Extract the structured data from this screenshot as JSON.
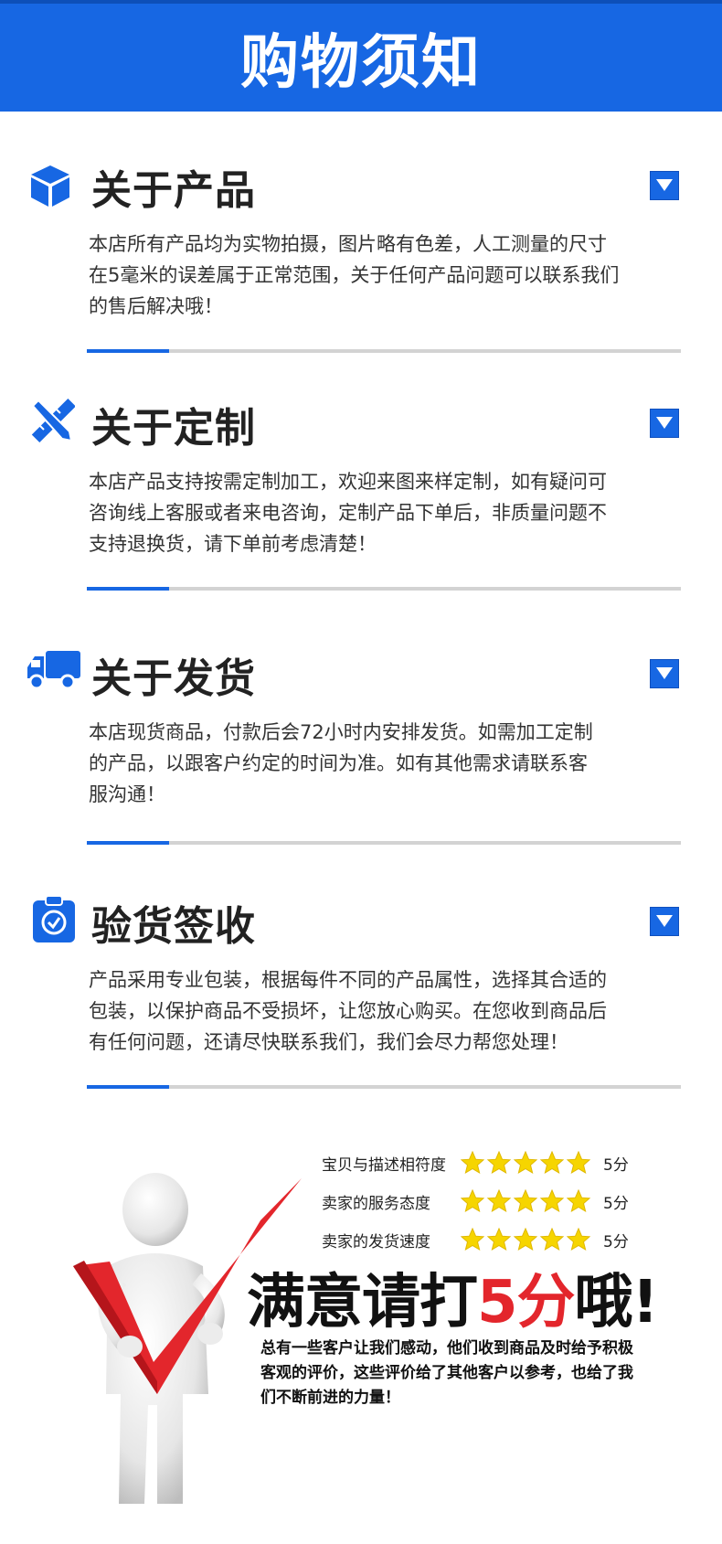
{
  "header": {
    "title": "购物须知"
  },
  "sections": [
    {
      "icon": "box-icon",
      "title": "关于产品",
      "lines": [
        "本店所有产品均为实物拍摄，图片略有色差，人工测量的尺寸",
        "在5毫米的误差属于正常范围，关于任何产品问题可以联系我们",
        "的售后解决哦！"
      ]
    },
    {
      "icon": "pencil-ruler-icon",
      "title": "关于定制",
      "lines": [
        "本店产品支持按需定制加工，欢迎来图来样定制，如有疑问可",
        "咨询线上客服或者来电咨询，定制产品下单后，非质量问题不",
        "支持退换货，请下单前考虑清楚！"
      ]
    },
    {
      "icon": "truck-icon",
      "title": "关于发货",
      "lines": [
        "本店现货商品，付款后会72小时内安排发货。如需加工定制",
        "的产品，以跟客户约定的时间为准。如有其他需求请联系客",
        "服沟通！"
      ]
    },
    {
      "icon": "clipboard-check-icon",
      "title": "验货签收",
      "lines": [
        "产品采用专业包装，根据每件不同的产品属性，选择其合适的",
        "包装，以保护商品不受损坏，让您放心购买。在您收到商品后",
        "有任何问题，还请尽快联系我们，我们会尽力帮您处理！"
      ]
    }
  ],
  "ratings": [
    {
      "label": "宝贝与描述相符度",
      "stars": 5,
      "score": "5分"
    },
    {
      "label": "卖家的服务态度",
      "stars": 5,
      "score": "5分"
    },
    {
      "label": "卖家的发货速度",
      "stars": 5,
      "score": "5分"
    }
  ],
  "slogan": {
    "before": "满意请打",
    "highlight": "5分",
    "after": "哦!"
  },
  "thanks_lines": [
    "总有一些客户让我们感动，他们收到商品及时给予积极",
    "客观的评价，这些评价给了其他客户以参考，也给了我",
    "们不断前进的力量！"
  ],
  "colors": {
    "brand_blue": "#1767e3",
    "highlight_red": "#e3262c",
    "star_yellow": "#f6d500"
  }
}
